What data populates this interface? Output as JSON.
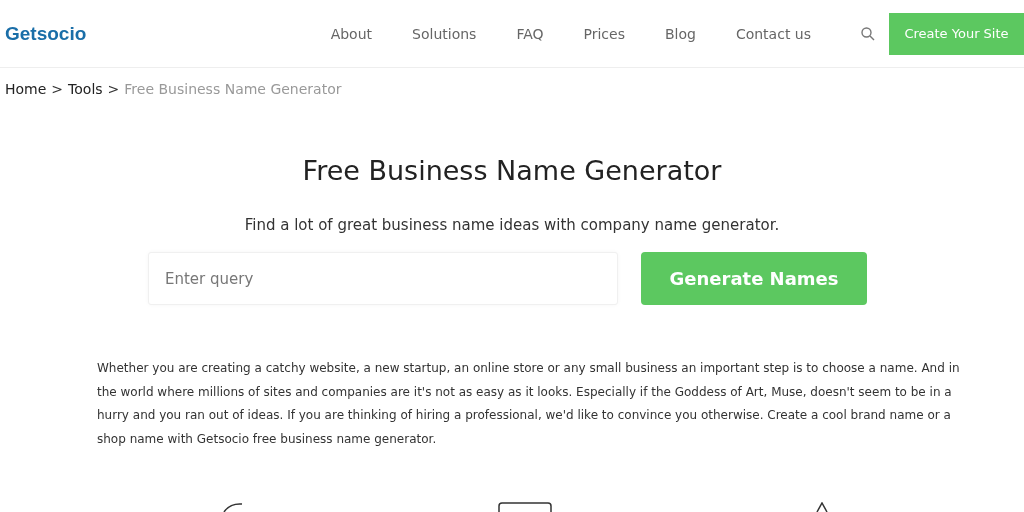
{
  "header": {
    "logo": "Getsocio",
    "nav": [
      {
        "label": "About"
      },
      {
        "label": "Solutions"
      },
      {
        "label": "FAQ"
      },
      {
        "label": "Prices"
      },
      {
        "label": "Blog"
      },
      {
        "label": "Contact us"
      }
    ],
    "cta": "Create Your Site"
  },
  "breadcrumb": [
    {
      "label": "Home",
      "current": false
    },
    {
      "label": "Tools",
      "current": false
    },
    {
      "label": "Free Business Name Generator",
      "current": true
    }
  ],
  "breadcrumb_separator": ">",
  "title": "Free Business Name Generator",
  "subtitle": "Find a lot of great business name ideas with company name generator.",
  "search": {
    "placeholder": "Enter query",
    "button": "Generate Names"
  },
  "description": "Whether you are creating a catchy website, a new startup, an online store or any small business an important step is to choose a name. And in the world where millions of sites and companies are it's not as easy as it looks. Especially if the Goddess of Art, Muse, doesn't seem to be in a hurry and you ran out of ideas. If you are thinking of hiring a professional, we'd like to convince you otherwise. Create a cool brand name or a shop name with Getsocio free business name generator."
}
